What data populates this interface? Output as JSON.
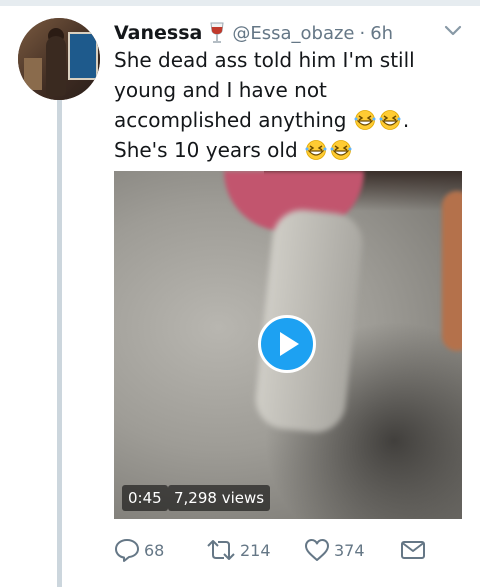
{
  "tweet": {
    "author_name": "Vanessa",
    "handle": "@Essa_obaze",
    "separator": "·",
    "time": "6h",
    "text_part1": "She dead ass told him I'm still young and I have not accomplished anything",
    "text_part2": ". She's 10 years old",
    "name_emoji": "wine-glass-icon",
    "inline_emoji": "grinning-squinting-face-icon"
  },
  "video": {
    "duration": "0:45",
    "views": "7,298 views"
  },
  "actions": {
    "replies": "68",
    "retweets": "214",
    "likes": "374"
  },
  "colors": {
    "accent": "#1da1f2",
    "muted": "#657786",
    "thread_line": "#ccd6dd"
  }
}
